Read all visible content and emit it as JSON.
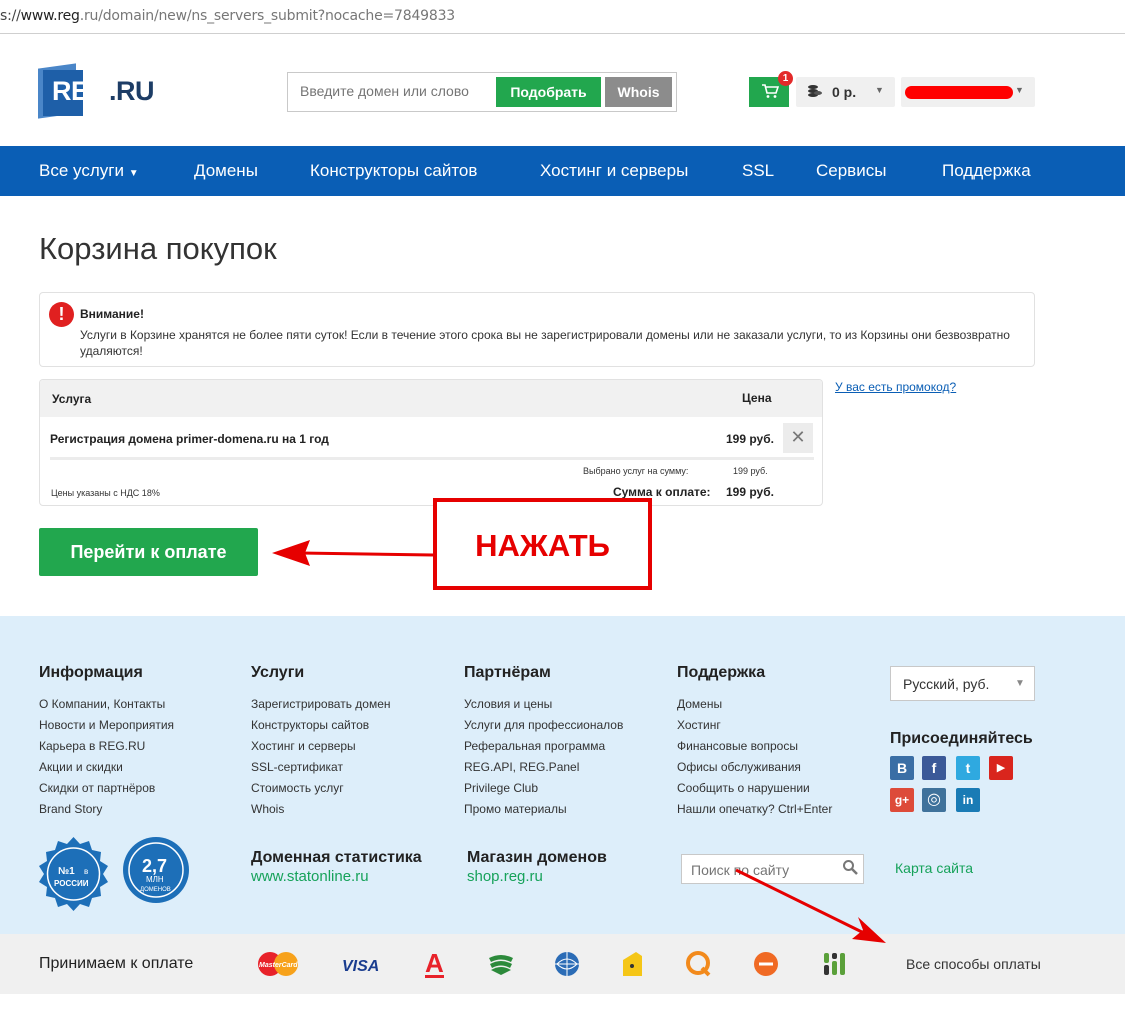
{
  "browser": {
    "url_prefix": "s://",
    "url_host": "www.reg",
    "url_rest": ".ru/domain/new/ns_servers_submit?nocache=7849833"
  },
  "header": {
    "logo_left": "REG",
    "logo_right": ".RU",
    "search_placeholder": "Введите домен или слово",
    "pick_label": "Подобрать",
    "whois_label": "Whois",
    "cart_count": "1",
    "balance": "0 р.",
    "user_name_redacted": true
  },
  "nav": {
    "items": [
      "Все услуги",
      "Домены",
      "Конструкторы сайтов",
      "Хостинг и серверы",
      "SSL",
      "Сервисы",
      "Поддержка"
    ]
  },
  "page": {
    "title": "Корзина покупок"
  },
  "alert": {
    "heading": "Внимание!",
    "text": "Услуги в Корзине хранятся не более пяти суток! Если в течение этого срока вы не зарегистрировали домены или не заказали услуги, то из Корзины они безвозвратно удаляются!"
  },
  "cart": {
    "col_service": "Услуга",
    "col_price": "Цена",
    "items": [
      {
        "name": "Регистрация домена primer-domena.ru на 1 год",
        "price": "199 руб."
      }
    ],
    "selected_label": "Выбрано услуг на сумму:",
    "selected_value": "199 руб.",
    "vat_note": "Цены указаны с НДС 18%",
    "total_label": "Сумма к оплате:",
    "total_value": "199 руб.",
    "promo_link": "У вас есть промокод?",
    "pay_button": "Перейти к оплате"
  },
  "annotation": {
    "text": "НАЖАТЬ",
    "color": "#e60000"
  },
  "footer": {
    "columns": [
      {
        "heading": "Информация",
        "links": [
          "О Компании, Контакты",
          "Новости и Мероприятия",
          "Карьера в REG.RU",
          "Акции и скидки",
          "Скидки от партнёров",
          "Brand Story"
        ]
      },
      {
        "heading": "Услуги",
        "links": [
          "Зарегистрировать домен",
          "Конструкторы сайтов",
          "Хостинг и серверы",
          "SSL-сертификат",
          "Стоимость услуг",
          "Whois"
        ]
      },
      {
        "heading": "Партнёрам",
        "links": [
          "Условия и цены",
          "Услуги для профессионалов",
          "Реферальная программа",
          "REG.API, REG.Panel",
          "Privilege Club",
          "Промо материалы"
        ]
      },
      {
        "heading": "Поддержка",
        "links": [
          "Домены",
          "Хостинг",
          "Финансовые вопросы",
          "Офисы обслуживания",
          "Сообщить о нарушении",
          "Нашли опечатку? Ctrl+Enter"
        ]
      }
    ],
    "language": "Русский, руб.",
    "join_heading": "Присоединяйтесь",
    "social": [
      {
        "icon": "vk-icon",
        "glyph": "В",
        "color": "#3a6ea5"
      },
      {
        "icon": "facebook-icon",
        "glyph": "f",
        "color": "#3b5998"
      },
      {
        "icon": "twitter-icon",
        "glyph": "t",
        "color": "#2fa9e0"
      },
      {
        "icon": "youtube-icon",
        "glyph": "▶",
        "color": "#d9251d"
      },
      {
        "icon": "googleplus-icon",
        "glyph": "g+",
        "color": "#dd4b39"
      },
      {
        "icon": "instagram-icon",
        "glyph": "◎",
        "color": "#3f729b"
      },
      {
        "icon": "linkedin-icon",
        "glyph": "in",
        "color": "#1a7bb5"
      }
    ],
    "badge1": {
      "top": "№1",
      "sub": "в",
      "bottom": "РОССИИ"
    },
    "badge2": {
      "big": "2,7",
      "mid": "МЛН",
      "bottom": "ДОМЕНОВ"
    },
    "stats": [
      {
        "heading": "Доменная статистика",
        "link": "www.statonline.ru"
      },
      {
        "heading": "Магазин доменов",
        "link": "shop.reg.ru"
      }
    ],
    "site_search_placeholder": "Поиск по сайту",
    "sitemap_link": "Карта сайта"
  },
  "payments": {
    "label": "Принимаем к оплате",
    "methods": [
      "MasterCard",
      "VISA",
      "А",
      "sberbank",
      "webmoney",
      "yandex",
      "qiwi",
      "e",
      "other"
    ],
    "all_link": "Все способы оплаты"
  }
}
